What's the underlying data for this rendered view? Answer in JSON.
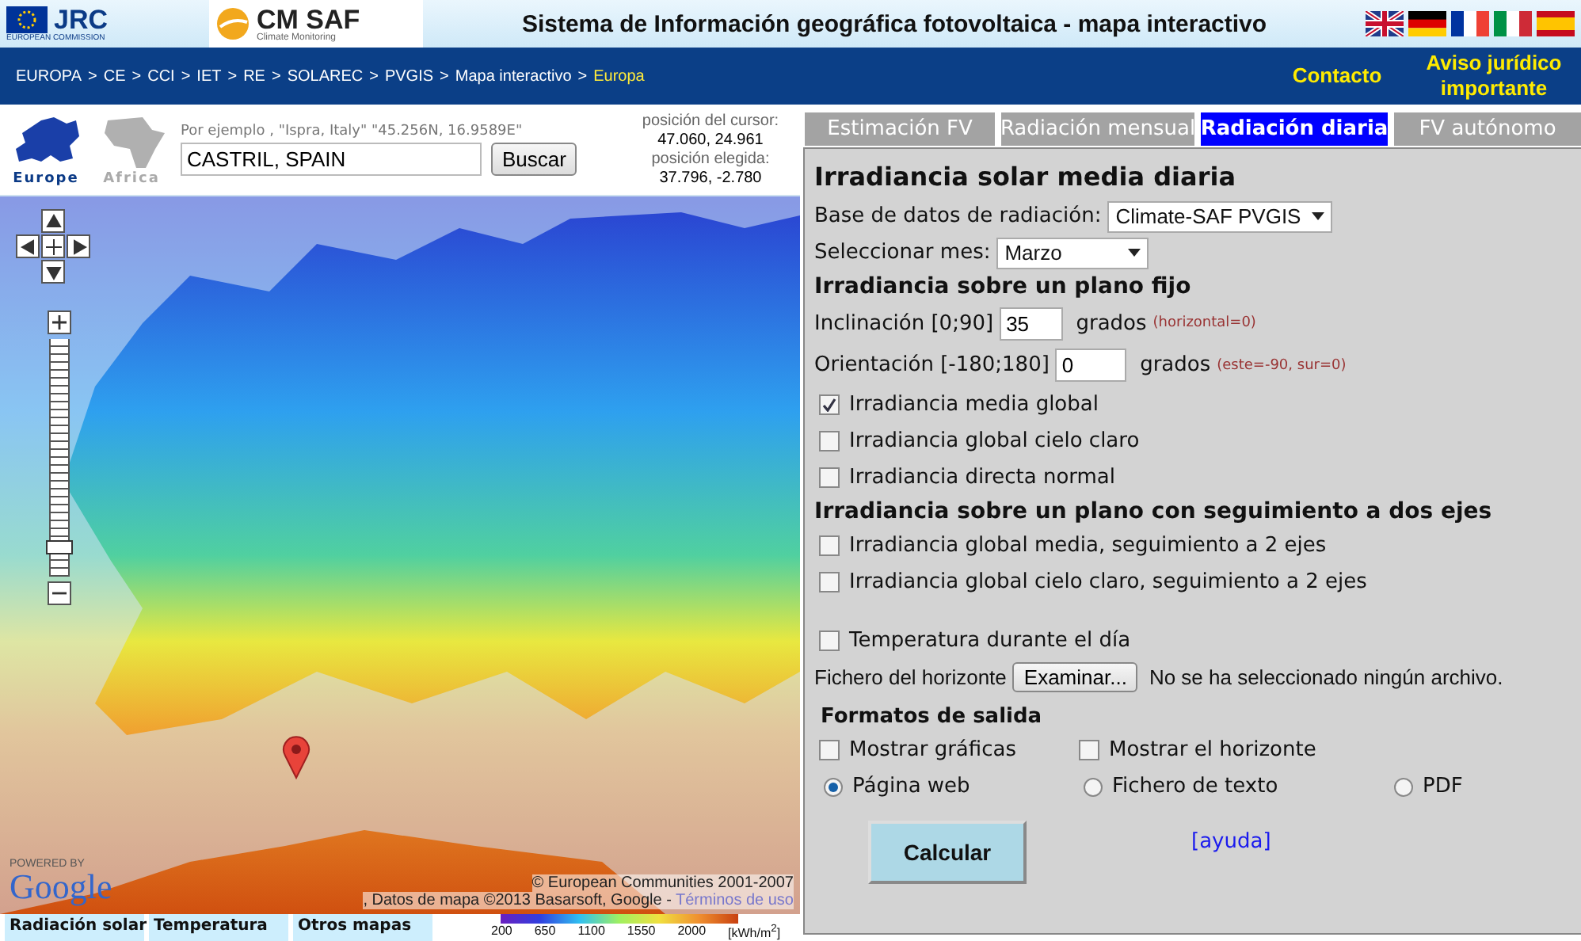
{
  "header": {
    "jrc_logo": {
      "title": "JRC",
      "subtitle": "EUROPEAN COMMISSION"
    },
    "cmsaf_logo": {
      "title": "CM SAF",
      "subtitle": "Climate Monitoring"
    },
    "title": "Sistema de Información geográfica fotovoltaica - mapa interactivo",
    "languages": [
      {
        "kind": "uk"
      },
      {
        "kind": "de"
      },
      {
        "kind": "fr"
      },
      {
        "kind": "it"
      },
      {
        "kind": "es"
      }
    ]
  },
  "nav": {
    "separator": ">",
    "breadcrumbs": [
      {
        "label": "EUROPA",
        "current": false
      },
      {
        "label": "CE",
        "current": false
      },
      {
        "label": "CCI",
        "current": false
      },
      {
        "label": "IET",
        "current": false
      },
      {
        "label": "RE",
        "current": false
      },
      {
        "label": "SOLAREC",
        "current": false
      },
      {
        "label": "PVGIS",
        "current": false
      },
      {
        "label": "Mapa interactivo",
        "current": false
      },
      {
        "label": "Europa",
        "current": true
      }
    ],
    "links": [
      "Contacto",
      "Aviso jurídico importante"
    ]
  },
  "regions": [
    {
      "label": "Europe",
      "selected": true
    },
    {
      "label": "Africa",
      "selected": false
    }
  ],
  "search": {
    "hint": "Por ejemplo , \"Ispra, Italy\" \"45.256N, 16.9589E\"",
    "value": "CASTRIL, SPAIN",
    "button": "Buscar"
  },
  "position": {
    "cursor_label": "posición del cursor:",
    "cursor_value": "47.060, 24.961",
    "chosen_label": "posición elegida:",
    "chosen_value": "37.796, -2.780"
  },
  "map": {
    "zoom": {
      "level": 0.1
    },
    "powered_by": "POWERED BY",
    "google": "Google",
    "attribution": [
      "© European Communities 2001-2007",
      ", Datos de mapa ©2013 Basarsoft, Google - "
    ],
    "terms_link": "Términos de uso"
  },
  "map_tabs": [
    "Radiación solar",
    "Temperatura",
    "Otros mapas"
  ],
  "legend": {
    "ticks": [
      "200",
      "650",
      "1100",
      "1550",
      "2000"
    ],
    "unit": "[kWh/m$^{2}$]"
  },
  "tabs": [
    {
      "label": "Estimación FV",
      "selected": false
    },
    {
      "label": "Radiación mensual",
      "selected": false
    },
    {
      "label": "Radiación diaria",
      "selected": true
    },
    {
      "label": "FV autónomo",
      "selected": false
    }
  ],
  "panel": {
    "title": "Irradiancia solar media diaria",
    "database": {
      "label": "Base de datos de radiación:",
      "value": "Climate-SAF PVGIS"
    },
    "month": {
      "label": "Seleccionar mes:",
      "value": "Marzo"
    },
    "fixed_heading": "Irradiancia sobre un plano fijo",
    "inclination": {
      "label": "Inclinación [0;90]",
      "value": "35",
      "unit": "grados",
      "hint": "(horizontal=0)"
    },
    "orientation": {
      "label": "Orientación [-180;180]",
      "value": "0",
      "unit": "grados",
      "hint": "(este=-90, sur=0)"
    },
    "fixed_options": [
      {
        "label": "Irradiancia media global",
        "checked": true
      },
      {
        "label": "Irradiancia global cielo claro",
        "checked": false
      },
      {
        "label": "Irradiancia directa normal",
        "checked": false
      }
    ],
    "tracking_heading": "Irradiancia sobre un plano con seguimiento a dos ejes",
    "tracking_options": [
      {
        "label": "Irradiancia global media, seguimiento a 2 ejes",
        "checked": false
      },
      {
        "label": "Irradiancia global cielo claro, seguimiento a 2 ejes",
        "checked": false
      }
    ],
    "temperature": {
      "label": "Temperatura durante el día",
      "checked": false
    },
    "horizon": {
      "label": "Fichero del horizonte",
      "button": "Examinar...",
      "status": "No se ha seleccionado ningún archivo."
    },
    "output_heading": "Formatos de salida",
    "output_checks": [
      {
        "label": "Mostrar gráficas",
        "checked": false
      },
      {
        "label": "Mostrar el horizonte",
        "checked": false
      }
    ],
    "output_formats": [
      {
        "label": "Página web",
        "selected": true
      },
      {
        "label": "Fichero de texto",
        "selected": false
      },
      {
        "label": "PDF",
        "selected": false
      }
    ],
    "calculate": "Calcular",
    "help": "[ayuda]"
  }
}
